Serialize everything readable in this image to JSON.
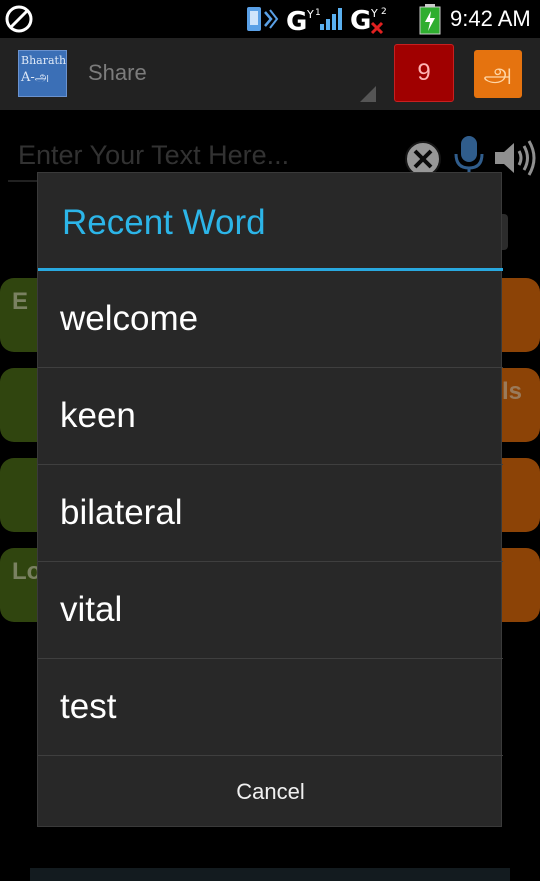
{
  "status_bar": {
    "time": "9:42 AM",
    "icons": [
      "no-sim-icon",
      "phone-sync-icon",
      "signal-g-icon",
      "signal-g2-icon",
      "battery-charging-icon"
    ]
  },
  "action_bar": {
    "logo_line1": "Bharath",
    "logo_line2": "A-அ",
    "share_label": "Share",
    "badge_count": "9",
    "lang_glyph": "அ"
  },
  "input": {
    "placeholder": "Enter Your Text Here..."
  },
  "background_buttons": {
    "b1": "E",
    "b4": "Lo",
    "b6": "ls"
  },
  "dialog": {
    "title": "Recent Word",
    "items": [
      {
        "label": "welcome"
      },
      {
        "label": "keen"
      },
      {
        "label": "bilateral"
      },
      {
        "label": "vital"
      },
      {
        "label": "test"
      }
    ],
    "cancel_label": "Cancel"
  },
  "colors": {
    "accent": "#2cb5e8",
    "badge": "#a00000",
    "orange": "#d8670a",
    "green": "#4b6b17"
  }
}
